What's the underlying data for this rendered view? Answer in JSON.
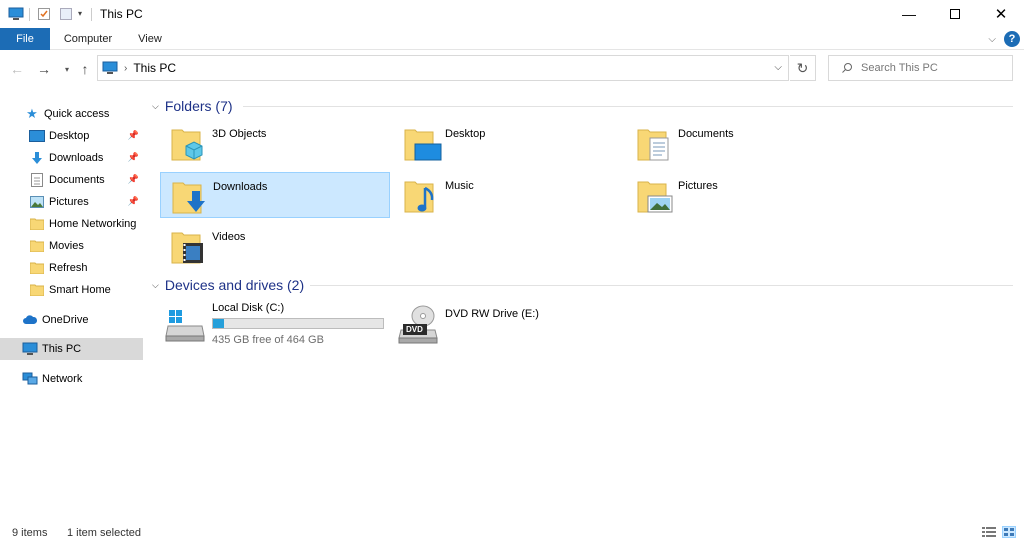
{
  "window": {
    "title": "This PC"
  },
  "ribbon": {
    "tabs": [
      {
        "label": "File"
      },
      {
        "label": "Computer"
      },
      {
        "label": "View"
      }
    ],
    "help": "?"
  },
  "address": {
    "path": "This PC",
    "search_placeholder": "Search This PC"
  },
  "sidebar": {
    "quick_access": "Quick access",
    "items": [
      {
        "label": "Desktop",
        "icon": "desktop-icon",
        "pinned": true
      },
      {
        "label": "Downloads",
        "icon": "download-icon",
        "pinned": true
      },
      {
        "label": "Documents",
        "icon": "documents-icon",
        "pinned": true
      },
      {
        "label": "Pictures",
        "icon": "pictures-icon",
        "pinned": true
      },
      {
        "label": "Home Networking",
        "icon": "folder-icon",
        "pinned": false
      },
      {
        "label": "Movies",
        "icon": "folder-icon",
        "pinned": false
      },
      {
        "label": "Refresh",
        "icon": "folder-icon",
        "pinned": false
      },
      {
        "label": "Smart Home",
        "icon": "folder-icon",
        "pinned": false
      }
    ],
    "onedrive": "OneDrive",
    "this_pc": "This PC",
    "network": "Network"
  },
  "main": {
    "folders_header": "Folders (7)",
    "folders": [
      {
        "label": "3D Objects",
        "icon": "3d-objects-folder-icon"
      },
      {
        "label": "Desktop",
        "icon": "desktop-folder-icon"
      },
      {
        "label": "Documents",
        "icon": "documents-folder-icon"
      },
      {
        "label": "Downloads",
        "icon": "downloads-folder-icon",
        "selected": true
      },
      {
        "label": "Music",
        "icon": "music-folder-icon"
      },
      {
        "label": "Pictures",
        "icon": "pictures-folder-icon"
      },
      {
        "label": "Videos",
        "icon": "videos-folder-icon"
      }
    ],
    "devices_header": "Devices and drives (2)",
    "drives": [
      {
        "label": "Local Disk (C:)",
        "free_text": "435 GB free of 464 GB",
        "used_fraction": 0.0625,
        "icon": "windows-drive-icon"
      },
      {
        "label": "DVD RW Drive (E:)",
        "icon": "dvd-drive-icon",
        "badge": "DVD"
      }
    ]
  },
  "status": {
    "count": "9 items",
    "selection": "1 item selected"
  },
  "colors": {
    "accent": "#1c6cb5",
    "folder_yellow": "#f8d775",
    "header_blue": "#1e3287",
    "selection_bg": "#cce8ff",
    "drive_fill": "#26a0da"
  }
}
